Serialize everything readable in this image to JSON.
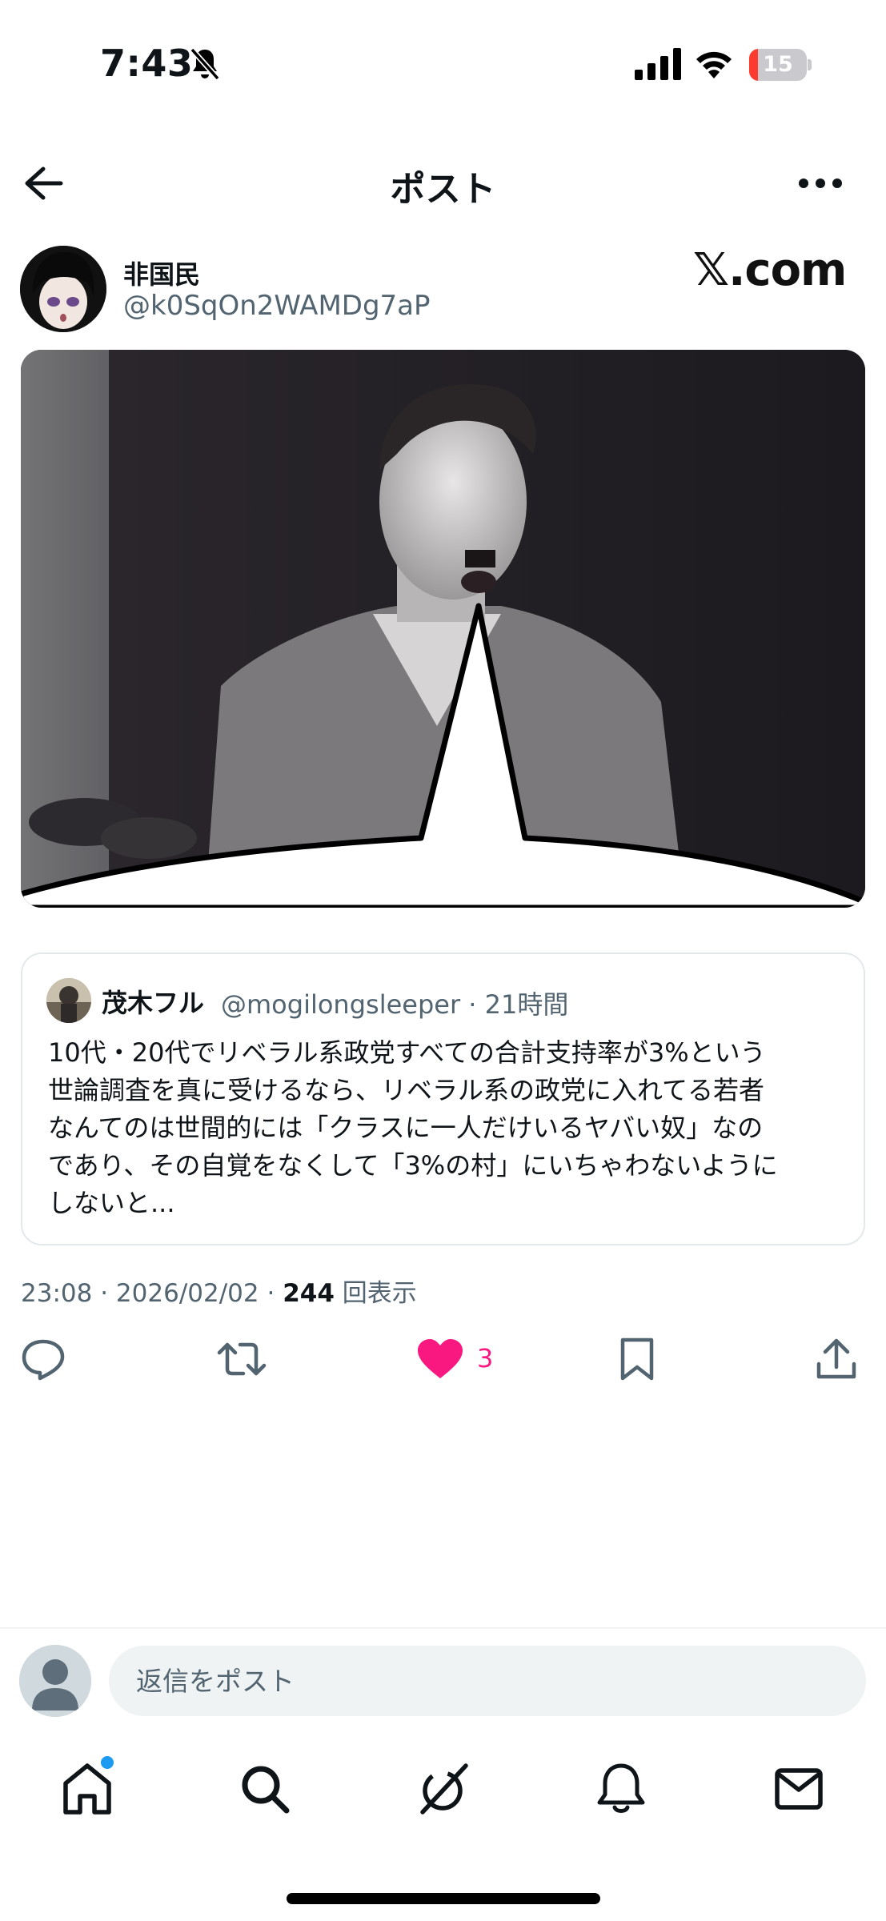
{
  "status_bar": {
    "time": "7:43",
    "battery": "15",
    "battery_level": 0.15
  },
  "header": {
    "title": "ポスト"
  },
  "author": {
    "name": "非国民",
    "handle": "@k0SqOn2WAMDg7aP"
  },
  "watermark": "𝕏.com",
  "quote": {
    "name": "茂木フル",
    "handle": "@mogilongsleeper",
    "time": "21時間",
    "text": "10代・20代でリベラル系政党すべての合計支持率が3%という\n世論調査を真に受けるなら、リベラル系の政党に入れてる若者\nなんてのは世間的には「クラスに一人だけいるヤバい奴」なの\nであり、その自覚をなくして「3%の村」にいちゃわないように\nしないと..."
  },
  "meta": {
    "time": "23:08",
    "date": "2026/02/02",
    "views": "244",
    "views_label": "回表示"
  },
  "actions": {
    "likes": "3",
    "like_color": "#f91880"
  },
  "reply": {
    "placeholder": "返信をポスト"
  },
  "nav": {
    "items": [
      "home-icon",
      "search-icon",
      "grok-icon",
      "notifications-icon",
      "messages-icon"
    ]
  },
  "colors": {
    "accent": "#1d9bf0",
    "secondary_text": "#536471",
    "like": "#f91880"
  }
}
